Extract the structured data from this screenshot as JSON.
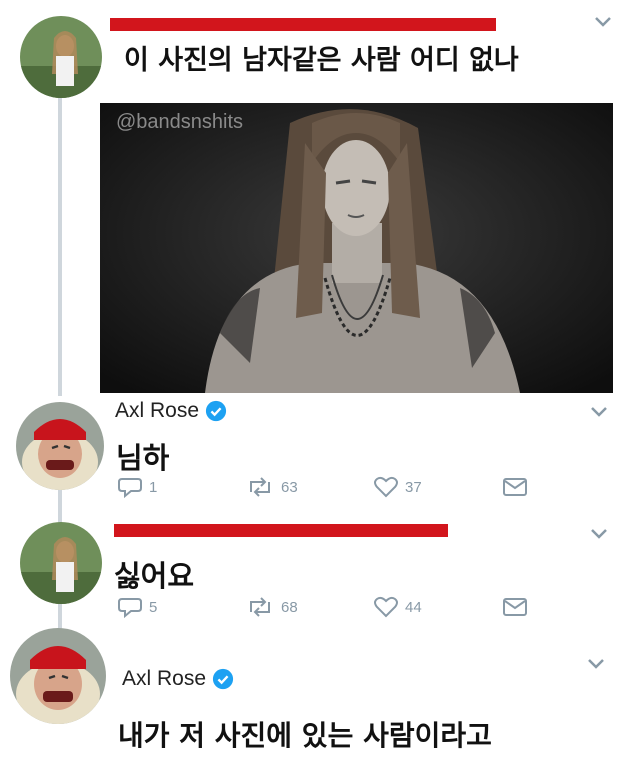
{
  "tweets": [
    {
      "text": "이 사진의 남자같은 사람 어디 없나",
      "photo": {
        "watermark": "@bandsnshits"
      }
    },
    {
      "author": "Axl Rose",
      "text": "님하",
      "stats": {
        "replies": "1",
        "retweets": "63",
        "likes": "37"
      }
    },
    {
      "text": "싫어요",
      "stats": {
        "replies": "5",
        "retweets": "68",
        "likes": "44"
      }
    },
    {
      "author": "Axl Rose",
      "text": "내가 저 사진에 있는 사람이라고"
    }
  ],
  "colors": {
    "redaction": "#d2151c",
    "verified": "#1da1f2",
    "muted": "#8899a6",
    "thread_line": "#cfd6dc"
  },
  "icons": [
    "reply-icon",
    "retweet-icon",
    "like-icon",
    "message-icon",
    "verified-badge-icon",
    "chevron-down-icon"
  ]
}
